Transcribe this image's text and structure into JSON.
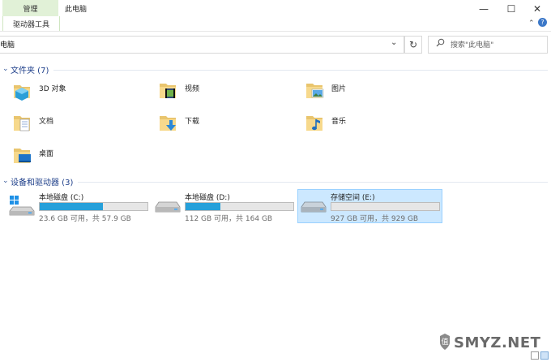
{
  "ribbon": {
    "manage_label": "管理",
    "drive_tools_label": "驱动器工具"
  },
  "window": {
    "title": "此电脑",
    "minimize": "—",
    "maximize": "☐",
    "close": "✕"
  },
  "address": {
    "path": "电脑",
    "refresh": "↻"
  },
  "search": {
    "placeholder": "搜索\"此电脑\""
  },
  "groups": {
    "folders_title": "文件夹 (7)",
    "drives_title": "设备和驱动器 (3)"
  },
  "folders": [
    {
      "label": "3D 对象",
      "icon": "3d-objects-icon"
    },
    {
      "label": "视频",
      "icon": "video-folder-icon"
    },
    {
      "label": "图片",
      "icon": "pictures-folder-icon"
    },
    {
      "label": "文档",
      "icon": "documents-folder-icon"
    },
    {
      "label": "下载",
      "icon": "downloads-folder-icon"
    },
    {
      "label": "音乐",
      "icon": "music-folder-icon"
    },
    {
      "label": "桌面",
      "icon": "desktop-folder-icon"
    }
  ],
  "drives": [
    {
      "name": "本地磁盘 (C:)",
      "free_text": "23.6 GB 可用，共 57.9 GB",
      "used_fraction": 0.59
    },
    {
      "name": "本地磁盘 (D:)",
      "free_text": "112 GB 可用，共 164 GB",
      "used_fraction": 0.32
    },
    {
      "name": "存储空间 (E:)",
      "free_text": "927 GB 可用，共 929 GB",
      "used_fraction": 0.0
    }
  ],
  "watermark": "SMYZ.NET",
  "colors": {
    "accent": "#26a0da",
    "selection": "#cce8ff",
    "group_title": "#1e3f8a"
  }
}
